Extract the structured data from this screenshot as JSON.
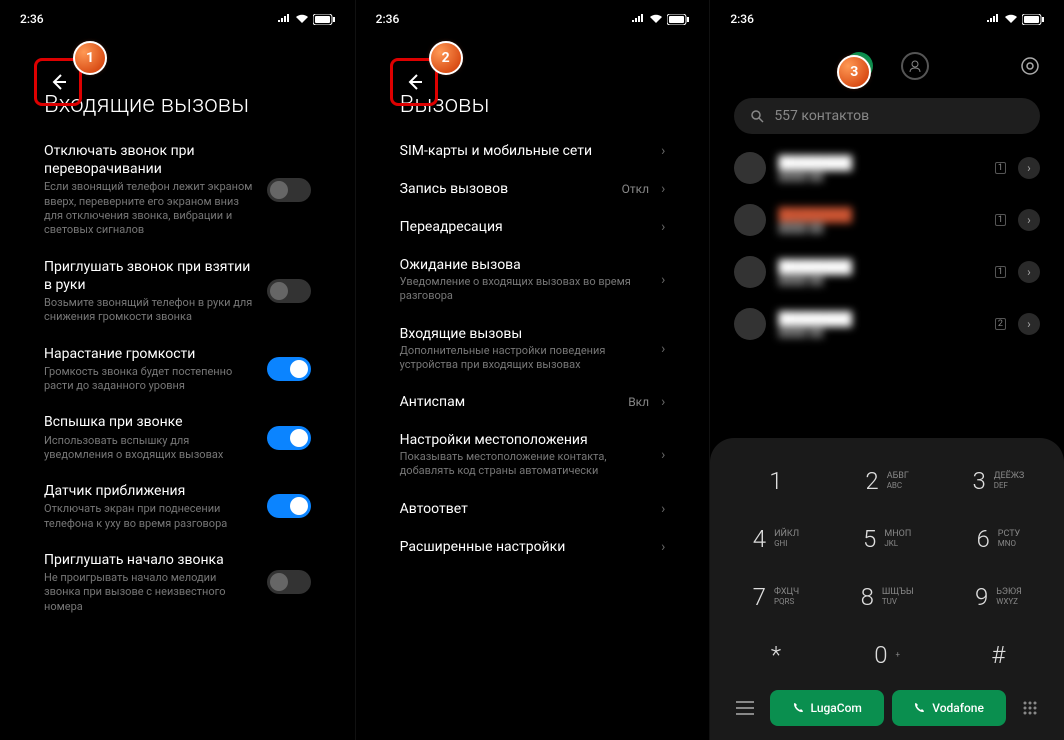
{
  "status": {
    "time": "2:36"
  },
  "badges": {
    "b1": "1",
    "b2": "2",
    "b3": "3"
  },
  "screen1": {
    "title": "Входящие вызовы",
    "items": [
      {
        "label": "Отключать звонок при переворачивании",
        "desc": "Если звонящий телефон лежит экраном вверх, переверните его экраном вниз для отключения звонка, вибрации и световых сигналов",
        "on": false
      },
      {
        "label": "Приглушать звонок при взятии в руки",
        "desc": "Возьмите звонящий телефон в руки для снижения громкости звонка",
        "on": false
      },
      {
        "label": "Нарастание громкости",
        "desc": "Громкость звонка будет постепенно расти до заданного уровня",
        "on": true
      },
      {
        "label": "Вспышка при звонке",
        "desc": "Использовать вспышку для уведомления о входящих вызовах",
        "on": true
      },
      {
        "label": "Датчик приближения",
        "desc": "Отключать экран при поднесении телефона к уху во время разговора",
        "on": true
      },
      {
        "label": "Приглушать начало звонка",
        "desc": "Не проигрывать начало мелодии звонка при вызове с неизвестного номера",
        "on": false
      }
    ]
  },
  "screen2": {
    "title": "Вызовы",
    "items": [
      {
        "label": "SIM-карты и мобильные сети",
        "desc": "",
        "value": ""
      },
      {
        "label": "Запись вызовов",
        "desc": "",
        "value": "Откл"
      },
      {
        "label": "Переадресация",
        "desc": "",
        "value": ""
      },
      {
        "label": "Ожидание вызова",
        "desc": "Уведомление о входящих вызовах во время разговора",
        "value": ""
      },
      {
        "label": "Входящие вызовы",
        "desc": "Дополнительные настройки поведения устройства при входящих вызовах",
        "value": ""
      },
      {
        "label": "Антиспам",
        "desc": "",
        "value": "Вкл"
      },
      {
        "label": "Настройки местоположения",
        "desc": "Показывать местоположение контакта, добавлять код страны автоматически",
        "value": ""
      },
      {
        "label": "Автоответ",
        "desc": "",
        "value": ""
      },
      {
        "label": "Расширенные настройки",
        "desc": "",
        "value": ""
      }
    ]
  },
  "screen3": {
    "search_placeholder": "557 контактов",
    "keys": [
      {
        "n": "1",
        "ru": "",
        "en": ""
      },
      {
        "n": "2",
        "ru": "АБВГ",
        "en": "ABC"
      },
      {
        "n": "3",
        "ru": "ДЕЁЖЗ",
        "en": "DEF"
      },
      {
        "n": "4",
        "ru": "ИЙКЛ",
        "en": "GHI"
      },
      {
        "n": "5",
        "ru": "МНОП",
        "en": "JKL"
      },
      {
        "n": "6",
        "ru": "РСТУ",
        "en": "MNO"
      },
      {
        "n": "7",
        "ru": "ФХЦЧ",
        "en": "PQRS"
      },
      {
        "n": "8",
        "ru": "ШЩЪЫ",
        "en": "TUV"
      },
      {
        "n": "9",
        "ru": "ЬЭЮЯ",
        "en": "WXYZ"
      },
      {
        "n": "*",
        "ru": "",
        "en": ""
      },
      {
        "n": "0",
        "ru": "",
        "en": "+"
      },
      {
        "n": "#",
        "ru": "",
        "en": ""
      }
    ],
    "sim1": "LugaCom",
    "sim2": "Vodafone",
    "contacts": [
      {
        "sim": "1",
        "red": false
      },
      {
        "sim": "1",
        "red": true
      },
      {
        "sim": "1",
        "red": false
      },
      {
        "sim": "2",
        "red": false
      }
    ]
  }
}
